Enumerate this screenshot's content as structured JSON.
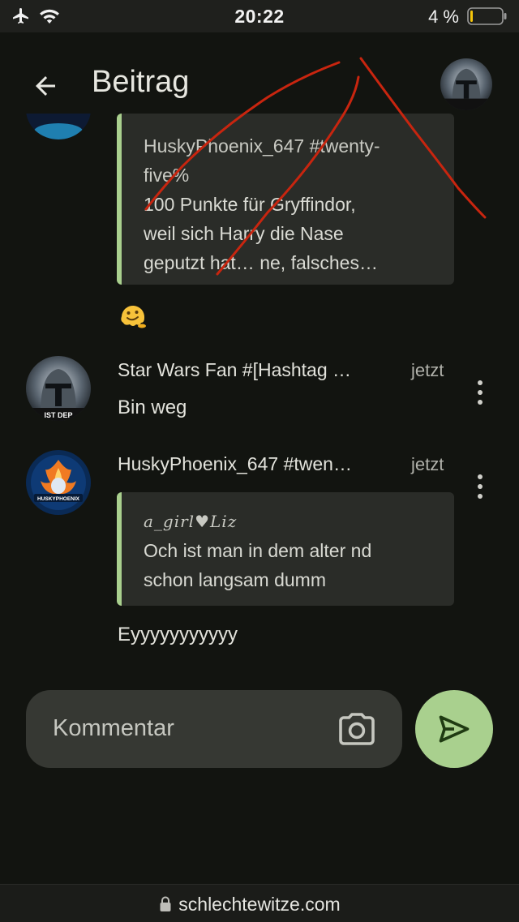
{
  "status_bar": {
    "time": "20:22",
    "battery_text": "4 %",
    "battery_level": 0.04,
    "icons": [
      "airplane-icon",
      "wifi-icon",
      "battery-icon"
    ]
  },
  "app_bar": {
    "title": "Beitrag",
    "back_icon": "arrow-left-icon"
  },
  "thread": {
    "quoted_post": {
      "author": "HuskyPhoenix_647 #twenty-five%",
      "author_line1": "HuskyPhoenix_647 #twenty-",
      "author_line2": "five%",
      "text_line1": "100 Punkte für Gryffindor,",
      "text_line2": "weil sich Harry die Nase",
      "text_line3": "geputzt hat… ne, falsches…"
    },
    "reaction_emoji": "🫠",
    "comments": [
      {
        "author": "Star Wars Fan #[Hashtag …",
        "time": "jetzt",
        "avatar_caption": "IST DEP",
        "text": "Bin weg"
      },
      {
        "author": "HuskyPhoenix_647 #twen…",
        "time": "jetzt",
        "avatar_caption": "HUSKYPHOENIX",
        "quote_author": "a_girl♥Liz",
        "quote_line1": "Och ist man in dem alter nd",
        "quote_line2": "schon langsam dumm",
        "text": "Eyyyyyyyyyyy"
      }
    ]
  },
  "comment_bar": {
    "placeholder": "Kommentar",
    "camera_icon": "camera-icon",
    "send_icon": "send-icon"
  },
  "browser": {
    "url": "schlechtewitze.com"
  },
  "colors": {
    "background": "#121410",
    "accent": "#a9d08e",
    "scribble": "#c8250f"
  }
}
